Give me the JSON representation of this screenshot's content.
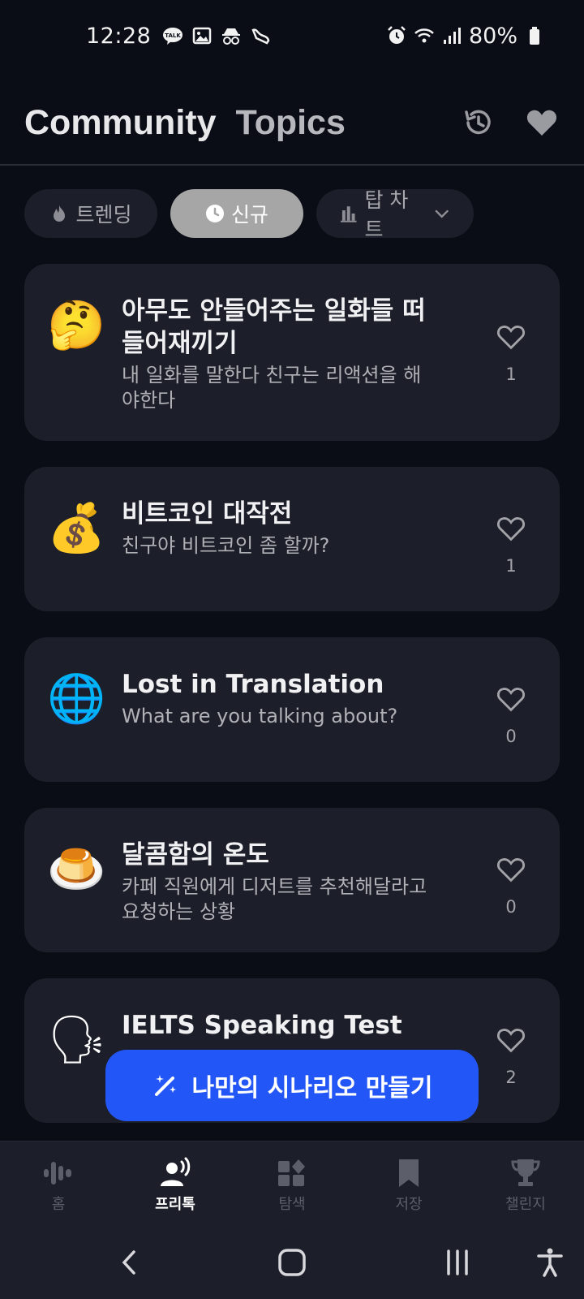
{
  "status_bar": {
    "time": "12:28",
    "battery": "80%",
    "left_icons": [
      "talk-icon",
      "image-icon",
      "incognito-icon",
      "shoe-icon"
    ],
    "right_icons": [
      "alarm-icon",
      "wifi-icon",
      "signal-icon",
      "battery-icon"
    ]
  },
  "header": {
    "title_part1": "Community",
    "title_part2": "Topics",
    "history_icon": "history-icon",
    "favorites_icon": "heart-filled-icon"
  },
  "filters": {
    "trending": "트렌딩",
    "new": "신규",
    "top_chart": "탑 차트",
    "selected": "신규"
  },
  "topics": [
    {
      "emoji": "🤔",
      "title": "아무도 안들어주는 일화들 떠들어재끼기",
      "subtitle": "내 일화를 말한다 친구는 리액션을 해야한다",
      "likes": "1"
    },
    {
      "emoji": "💰",
      "title": "비트코인 대작전",
      "subtitle": "친구야 비트코인 좀 할까?",
      "likes": "1"
    },
    {
      "emoji": "🌐",
      "title": "Lost in Translation",
      "subtitle": "What are you talking about?",
      "likes": "0"
    },
    {
      "emoji": "🍮",
      "title": "달콤함의 온도",
      "subtitle": "카페 직원에게 디저트를 추천해달라고 요청하는 상황",
      "likes": "0"
    },
    {
      "emoji": "🗣",
      "title": "IELTS Speaking Test",
      "subtitle": "",
      "likes": "2"
    }
  ],
  "fab": {
    "label": "나만의 시나리오 만들기"
  },
  "bottom_nav": [
    {
      "label": "홈",
      "icon": "waveform-icon"
    },
    {
      "label": "프리톡",
      "icon": "person-speaking-icon"
    },
    {
      "label": "탐색",
      "icon": "apps-icon"
    },
    {
      "label": "저장",
      "icon": "bookmark-icon"
    },
    {
      "label": "챌린지",
      "icon": "trophy-icon"
    }
  ],
  "active_tab": "프리톡",
  "colors": {
    "background": "#0b0d16",
    "card": "#1c1f29",
    "accent": "#2356f6",
    "chip_active": "#a6a6a6"
  }
}
